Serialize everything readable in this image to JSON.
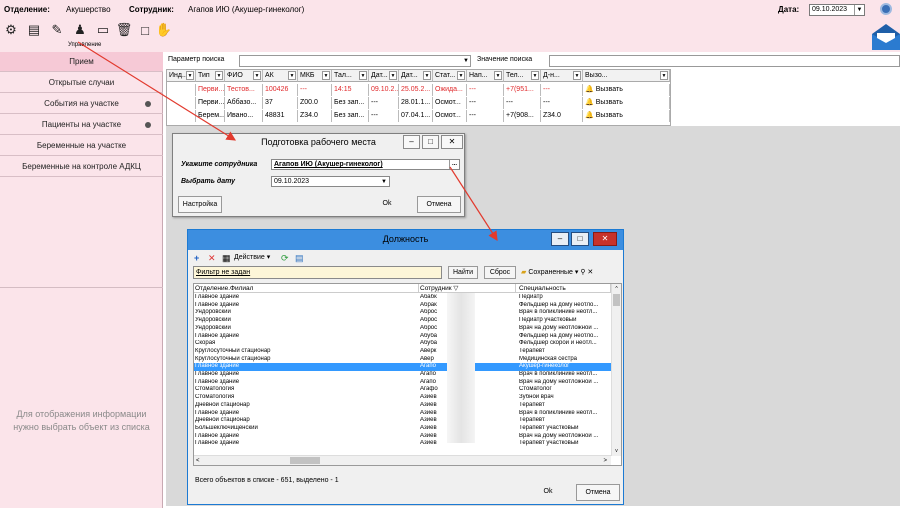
{
  "header": {
    "department_label": "Отделение:",
    "department_value": "Акушерство",
    "employee_label": "Сотрудник:",
    "employee_value": "Агапов ИЮ (Акушер-гинеколог)",
    "date_label": "Дата:",
    "date_value": "09.10.2023",
    "toolbar_caption": "Управление"
  },
  "sidebar": {
    "items": [
      {
        "label": "Прием"
      },
      {
        "label": "Открытые случаи"
      },
      {
        "label": "События на участке"
      },
      {
        "label": "Пациенты на участке"
      },
      {
        "label": "Беременные на участке"
      },
      {
        "label": "Беременные на контроле АДКЦ"
      }
    ],
    "empty_message_line1": "Для отображения информации",
    "empty_message_line2": "нужно выбрать объект из списка"
  },
  "search": {
    "param_label": "Параметр поиска",
    "value_label": "Значение поиска"
  },
  "grid": {
    "columns": [
      "Инд...",
      "Тип",
      "ФИО",
      "АК",
      "МКБ",
      "Тал...",
      "Дат...",
      "Дат...",
      "Стат...",
      "Нап...",
      "Тел...",
      "Д-н...",
      "Вызо..."
    ],
    "rows": [
      [
        "",
        "Перви...",
        "Тестов...",
        "100426",
        "---",
        "14:15",
        "09.10.2...",
        "25.05.2...",
        "Ожида...",
        "---",
        "+7(951...",
        "---",
        "Вызвать"
      ],
      [
        "",
        "Перви...",
        "Аббазо...",
        "37",
        "Z00.0",
        "Без зап...",
        "---",
        "28.01.1...",
        "Осмот...",
        "---",
        "---",
        "---",
        "Вызвать"
      ],
      [
        "",
        "Берем...",
        "Ивано...",
        "48831",
        "Z34.0",
        "Без зап...",
        "---",
        "07.04.1...",
        "Осмот...",
        "---",
        "+7(908...",
        "Z34.0",
        "Вызвать"
      ]
    ]
  },
  "workplace_dialog": {
    "title": "Подготовка рабочего места",
    "employee_label": "Укажите сотрудника",
    "employee_value": "Агапов ИЮ (Акушер-гинеколог)",
    "date_label": "Выбрать дату",
    "date_value": "09.10.2023",
    "settings_button": "Настройка",
    "ok_button": "Ok",
    "cancel_button": "Отмена"
  },
  "position_dialog": {
    "title": "Должность",
    "action_label": "Действие",
    "filter_text": "Фильтр не задан",
    "find_button": "Найти",
    "reset_button": "Сброс",
    "saved_label": "Сохраненные",
    "columns": [
      "Отделение.Филиал",
      "Сотрудник",
      "Специальность"
    ],
    "rows": [
      {
        "dept": "Главное здание",
        "emp": "Абабк",
        "spec": "Педиатр"
      },
      {
        "dept": "Главное здание",
        "emp": "Абрак",
        "spec": "Фельдшер на дому неотло..."
      },
      {
        "dept": "Ундоровский",
        "emp": "Аброс",
        "spec": "Врач в поликлинике неотл..."
      },
      {
        "dept": "Ундоровский",
        "emp": "Аброс",
        "spec": "Педиатр участковый"
      },
      {
        "dept": "Ундоровский",
        "emp": "Аброс",
        "spec": "Врач на дому неотложной ..."
      },
      {
        "dept": "Главное здание",
        "emp": "Абуба",
        "spec": "Фельдшер на дому неотло..."
      },
      {
        "dept": "Скорая",
        "emp": "Абуба",
        "spec": "Фельдшер скорой и неотл..."
      },
      {
        "dept": "Круглосуточный стационар",
        "emp": "Аверк",
        "spec": "Терапевт"
      },
      {
        "dept": "Круглосуточный стационар",
        "emp": "Авер",
        "spec": "Медицинская сестра"
      },
      {
        "dept": "Главное здание",
        "emp": "Агапо",
        "spec": "Акушер-гинеколог",
        "selected": true
      },
      {
        "dept": "Главное здание",
        "emp": "Агапо",
        "spec": "Врач в поликлинике неотл..."
      },
      {
        "dept": "Главное здание",
        "emp": "Агапо",
        "spec": "Врач на дому неотложной ..."
      },
      {
        "dept": "Стоматология",
        "emp": "Агафо",
        "spec": "Стоматолог"
      },
      {
        "dept": "Стоматология",
        "emp": "Азиев",
        "spec": "Зубной врач"
      },
      {
        "dept": "Дневной стационар",
        "emp": "Азиев",
        "spec": "Терапевт"
      },
      {
        "dept": "Главное здание",
        "emp": "Азиев",
        "spec": "Врач в поликлинике неотл..."
      },
      {
        "dept": "Дневной стационар",
        "emp": "Азиев",
        "spec": "Терапевт"
      },
      {
        "dept": "Большеключищенский",
        "emp": "Азиев",
        "spec": "Терапевт участковый"
      },
      {
        "dept": "Главное здание",
        "emp": "Азиев",
        "spec": "Врач на дому неотложной ..."
      },
      {
        "dept": "Главное здание",
        "emp": "Азиев",
        "spec": "Терапевт участковый"
      }
    ],
    "status_text": "Всего объектов в списке - 651, выделено - 1",
    "ok_button": "Ok",
    "cancel_button": "Отмена"
  }
}
